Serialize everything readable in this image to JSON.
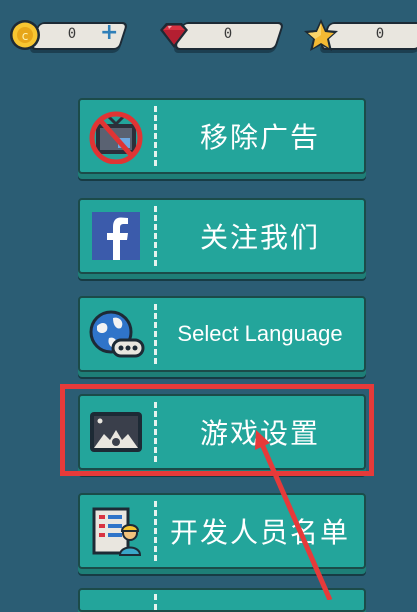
{
  "topbar": {
    "coins": "0",
    "gems": "0",
    "stars": "0"
  },
  "menu": {
    "items": [
      {
        "label": "移除广告",
        "icon": "no-ads-icon"
      },
      {
        "label": "关注我们",
        "icon": "facebook-icon"
      },
      {
        "label": "Select Language",
        "icon": "globe-language-icon"
      },
      {
        "label": "游戏设置",
        "icon": "settings-screen-icon"
      },
      {
        "label": "开发人员名单",
        "icon": "developer-credits-icon"
      }
    ]
  },
  "colors": {
    "background": "#2b5d74",
    "button": "#23a59b",
    "highlight": "#e63a3a"
  }
}
